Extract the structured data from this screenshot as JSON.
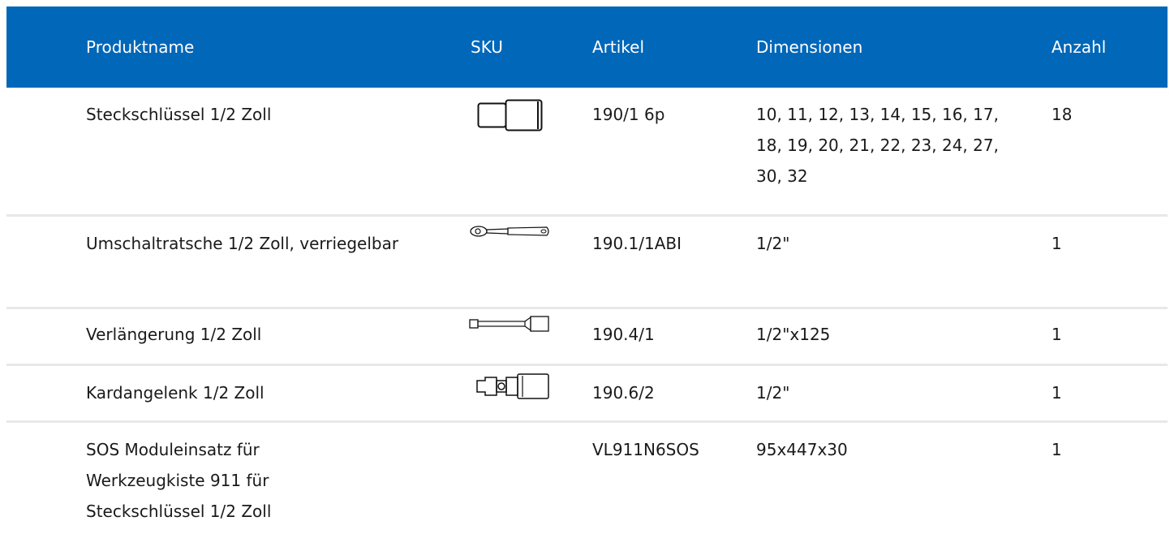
{
  "header": {
    "name": "Produktname",
    "sku": "SKU",
    "artikel": "Artikel",
    "dimensionen": "Dimensionen",
    "anzahl": "Anzahl"
  },
  "accent_color": "#0067b9",
  "rows": [
    {
      "name": "Steckschlüssel 1/2 Zoll",
      "sku_icon": "socket-icon",
      "artikel": "190/1 6p",
      "dimensionen": "10, 11, 12, 13, 14, 15, 16, 17, 18, 19, 20, 21, 22, 23, 24, 27, 30, 32",
      "anzahl": "18"
    },
    {
      "name": "Umschaltratsche 1/2 Zoll, verriegelbar",
      "sku_icon": "ratchet-icon",
      "artikel": "190.1/1ABI",
      "dimensionen": "1/2\"",
      "anzahl": "1"
    },
    {
      "name": "Verlängerung 1/2 Zoll",
      "sku_icon": "extension-bar-icon",
      "artikel": "190.4/1",
      "dimensionen": "1/2\"x125",
      "anzahl": "1"
    },
    {
      "name": "Kardangelenk 1/2 Zoll",
      "sku_icon": "universal-joint-icon",
      "artikel": "190.6/2",
      "dimensionen": "1/2\"",
      "anzahl": "1"
    },
    {
      "name": "SOS Moduleinsatz für Werkzeugkiste 911 für Steckschlüssel 1/2 Zoll",
      "sku_icon": "",
      "artikel": "VL911N6SOS",
      "dimensionen": "95x447x30",
      "anzahl": "1"
    }
  ]
}
